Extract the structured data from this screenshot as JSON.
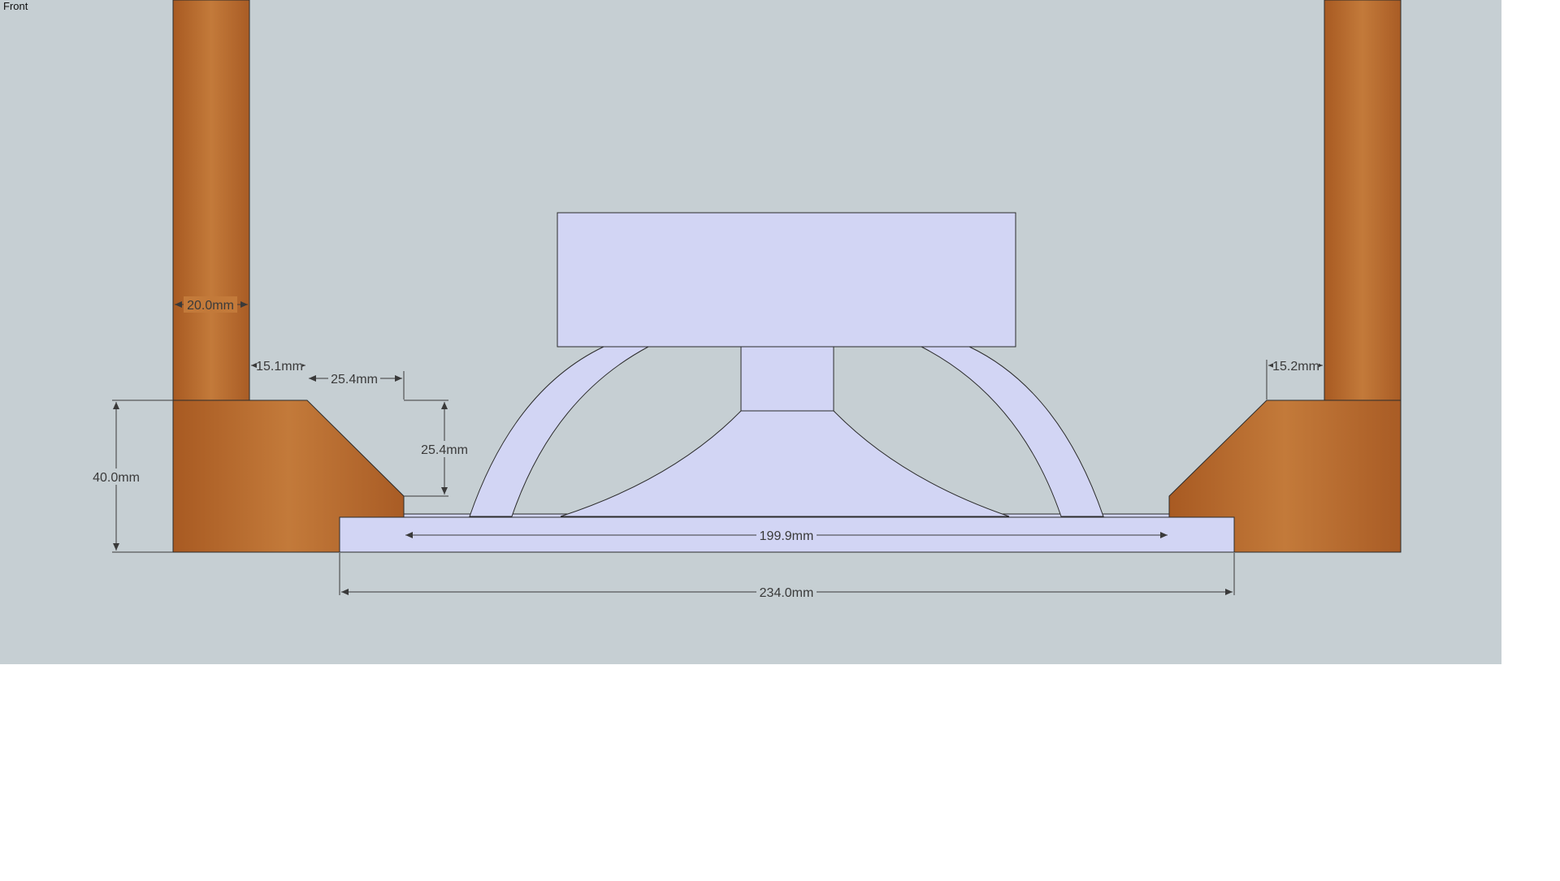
{
  "view": {
    "label": "Front"
  },
  "colors": {
    "background": "#c6cfd3",
    "wood": "#b5692c",
    "part": "#d2d5f4",
    "line": "#2b2b2b"
  },
  "dimensions": {
    "left_wall_thickness": "20.0mm",
    "left_gap": "15.1mm",
    "bevel_width": "25.4mm",
    "bevel_height": "25.4mm",
    "baffle_height": "40.0mm",
    "cutout_width": "199.9mm",
    "flange_width": "234.0mm",
    "right_gap": "15.2mm"
  }
}
